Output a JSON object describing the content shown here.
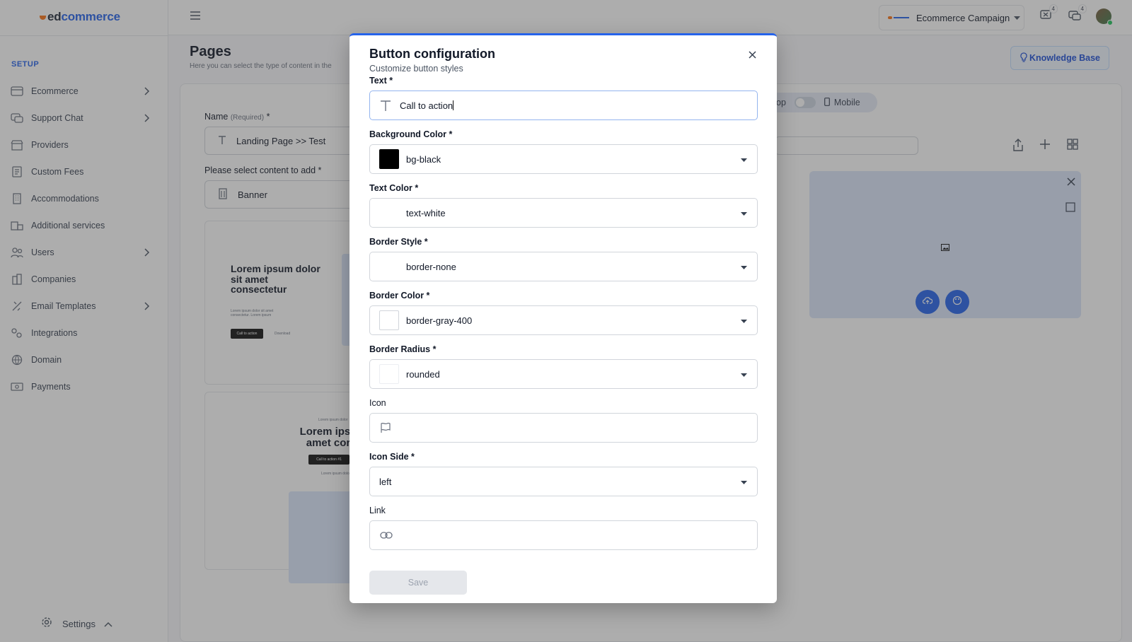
{
  "app": {
    "logo_part1": "ed",
    "logo_part2": "commerce"
  },
  "sidebar": {
    "section": "SETUP",
    "items": [
      {
        "label": "Ecommerce",
        "icon": "shopping-bag-icon",
        "chevron": true
      },
      {
        "label": "Support Chat",
        "icon": "chat-icon",
        "chevron": true
      },
      {
        "label": "Providers",
        "icon": "store-icon",
        "chevron": false
      },
      {
        "label": "Custom Fees",
        "icon": "receipt-icon",
        "chevron": false
      },
      {
        "label": "Accommodations",
        "icon": "building-icon",
        "chevron": false
      },
      {
        "label": "Additional services",
        "icon": "services-icon",
        "chevron": false
      },
      {
        "label": "Users",
        "icon": "users-icon",
        "chevron": true
      },
      {
        "label": "Companies",
        "icon": "companies-icon",
        "chevron": false
      },
      {
        "label": "Email Templates",
        "icon": "email-template-icon",
        "chevron": true
      },
      {
        "label": "Integrations",
        "icon": "integrations-icon",
        "chevron": false
      },
      {
        "label": "Domain",
        "icon": "globe-icon",
        "chevron": false
      },
      {
        "label": "Payments",
        "icon": "payments-icon",
        "chevron": false
      }
    ],
    "settings_label": "Settings"
  },
  "header": {
    "campaign_label": "Ecommerce Campaign",
    "notif_count": "4",
    "messages_count": "4"
  },
  "main": {
    "title": "Pages",
    "subtitle": "Here you can select the type of content in the",
    "knowledge_base": "Knowledge Base",
    "name_label": "Name",
    "name_required": "(Required)",
    "name_star": "*",
    "name_value": "Landing Page >> Test",
    "content_label": "Please select content to add *",
    "content_value": "Banner",
    "toggle_left": "op",
    "toggle_right": "Mobile",
    "preview1": {
      "heading": "Lorem ipsum dolor sit amet consectetur",
      "small": "Lorem ipsum dolor sit amet consectetur. Lorem ipsum",
      "cta": "Call to action",
      "secondary": "Download"
    },
    "preview2": {
      "small_top": "Lorem ipsum dolor",
      "heading": "Lorem ipsu amet cor",
      "cta": "Call to action #1",
      "small_bottom": "Lorem ipsum dolor"
    }
  },
  "modal": {
    "title": "Button configuration",
    "subtitle": "Customize button styles",
    "fields": {
      "text": {
        "label": "Text *",
        "value": "Call to action"
      },
      "background_color": {
        "label": "Background Color *",
        "value": "bg-black",
        "swatch": "#000000"
      },
      "text_color": {
        "label": "Text Color *",
        "value": "text-white",
        "swatch": "#ffffff"
      },
      "border_style": {
        "label": "Border Style *",
        "value": "border-none"
      },
      "border_color": {
        "label": "Border Color *",
        "value": "border-gray-400"
      },
      "border_radius": {
        "label": "Border Radius *",
        "value": "rounded"
      },
      "icon": {
        "label": "Icon",
        "value": ""
      },
      "icon_side": {
        "label": "Icon Side *",
        "value": "left"
      },
      "link": {
        "label": "Link",
        "value": ""
      }
    },
    "save_label": "Save"
  },
  "colors": {
    "accent": "#2563eb",
    "overlay": "rgba(60,60,60,0.42)"
  }
}
